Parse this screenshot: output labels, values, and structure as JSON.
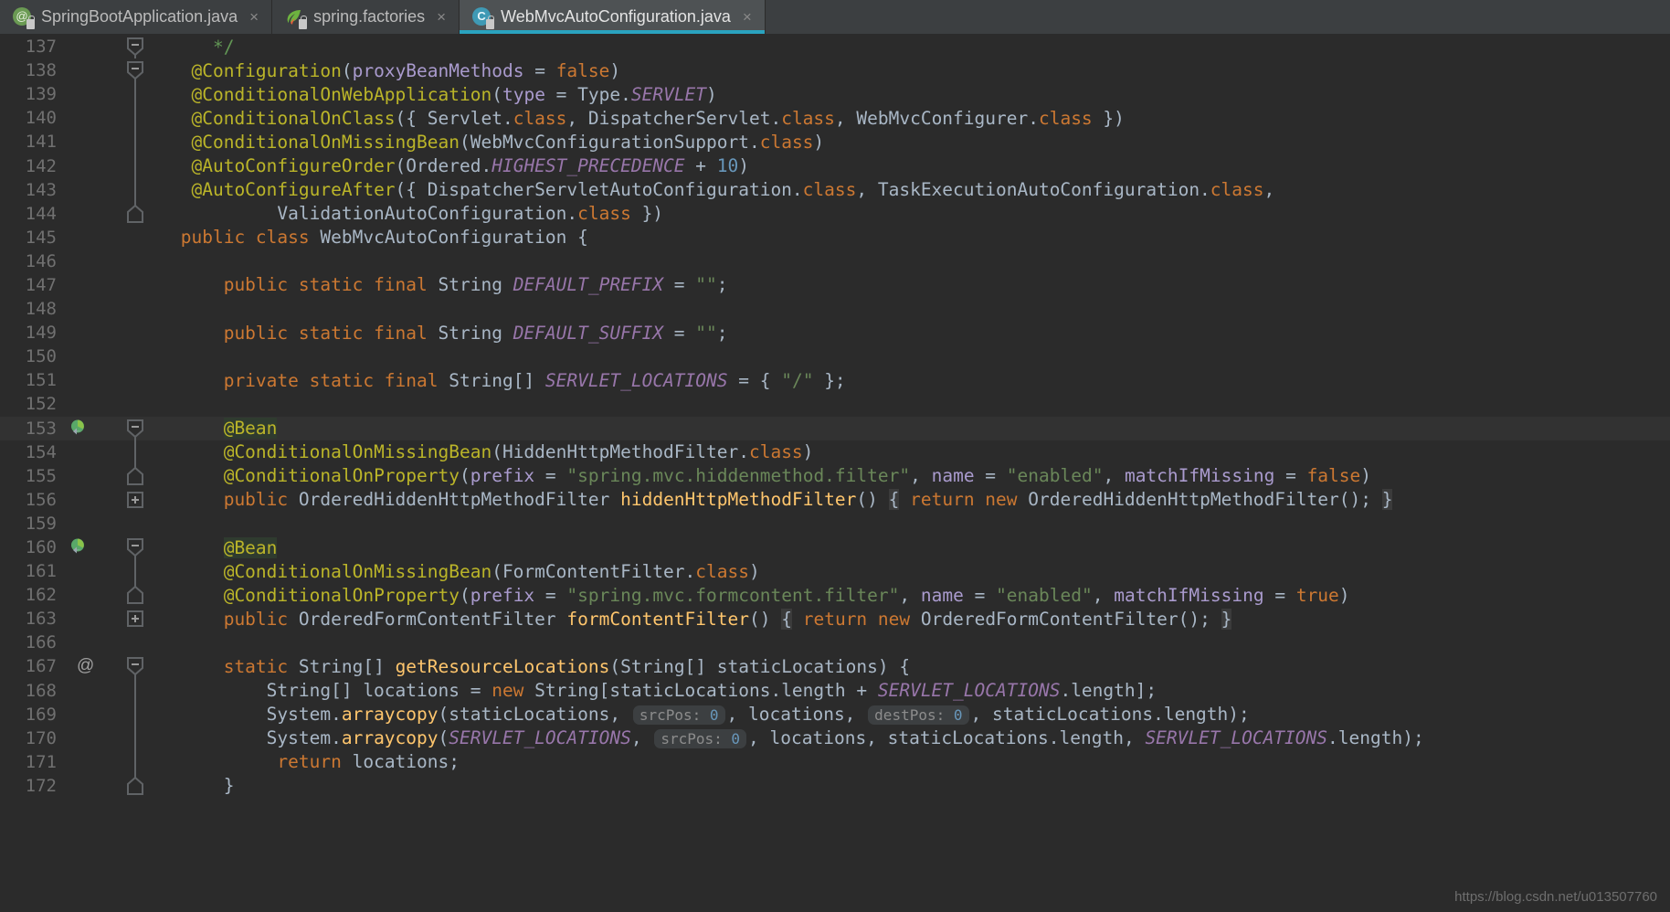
{
  "tabs": [
    {
      "label": "SpringBootApplication.java",
      "icon": "at-annotation-icon",
      "active": false,
      "close": "×"
    },
    {
      "label": "spring.factories",
      "icon": "spring-leaf-icon",
      "active": false,
      "close": "×"
    },
    {
      "label": "WebMvcAutoConfiguration.java",
      "icon": "java-class-icon",
      "active": true,
      "close": "×"
    }
  ],
  "editor": {
    "file": "WebMvcAutoConfiguration.java",
    "watermark": "https://blog.csdn.net/u013507760",
    "accent_color": "#2aa3bf",
    "background": "#2b2b2b",
    "lines": [
      {
        "n": "137",
        "gutter": "",
        "fold": "fold-open",
        "tokens": [
          {
            "t": "    ",
            "c": "typ"
          },
          {
            "t": "*/",
            "c": "cmt"
          }
        ]
      },
      {
        "n": "138",
        "gutter": "",
        "fold": "fold-open",
        "tokens": [
          {
            "t": "  ",
            "c": "typ"
          },
          {
            "t": "@Configuration",
            "c": "ann"
          },
          {
            "t": "(",
            "c": "typ"
          },
          {
            "t": "proxyBeanMethods",
            "c": "par"
          },
          {
            "t": " = ",
            "c": "typ"
          },
          {
            "t": "false",
            "c": "kw"
          },
          {
            "t": ")",
            "c": "typ"
          }
        ]
      },
      {
        "n": "139",
        "gutter": "",
        "fold": "line",
        "tokens": [
          {
            "t": "  ",
            "c": "typ"
          },
          {
            "t": "@ConditionalOnWebApplication",
            "c": "ann"
          },
          {
            "t": "(",
            "c": "typ"
          },
          {
            "t": "type",
            "c": "par"
          },
          {
            "t": " = Type.",
            "c": "typ"
          },
          {
            "t": "SERVLET",
            "c": "cst"
          },
          {
            "t": ")",
            "c": "typ"
          }
        ]
      },
      {
        "n": "140",
        "gutter": "",
        "fold": "line",
        "tokens": [
          {
            "t": "  ",
            "c": "typ"
          },
          {
            "t": "@ConditionalOnClass",
            "c": "ann"
          },
          {
            "t": "({ Servlet.",
            "c": "typ"
          },
          {
            "t": "class",
            "c": "kw"
          },
          {
            "t": ", DispatcherServlet.",
            "c": "typ"
          },
          {
            "t": "class",
            "c": "kw"
          },
          {
            "t": ", WebMvcConfigurer.",
            "c": "typ"
          },
          {
            "t": "class",
            "c": "kw"
          },
          {
            "t": " })",
            "c": "typ"
          }
        ]
      },
      {
        "n": "141",
        "gutter": "",
        "fold": "line",
        "tokens": [
          {
            "t": "  ",
            "c": "typ"
          },
          {
            "t": "@ConditionalOnMissingBean",
            "c": "ann"
          },
          {
            "t": "(WebMvcConfigurationSupport.",
            "c": "typ"
          },
          {
            "t": "class",
            "c": "kw"
          },
          {
            "t": ")",
            "c": "typ"
          }
        ]
      },
      {
        "n": "142",
        "gutter": "",
        "fold": "line",
        "tokens": [
          {
            "t": "  ",
            "c": "typ"
          },
          {
            "t": "@AutoConfigureOrder",
            "c": "ann"
          },
          {
            "t": "(Ordered.",
            "c": "typ"
          },
          {
            "t": "HIGHEST_PRECEDENCE",
            "c": "cst"
          },
          {
            "t": " + ",
            "c": "typ"
          },
          {
            "t": "10",
            "c": "num"
          },
          {
            "t": ")",
            "c": "typ"
          }
        ]
      },
      {
        "n": "143",
        "gutter": "",
        "fold": "line",
        "tokens": [
          {
            "t": "  ",
            "c": "typ"
          },
          {
            "t": "@AutoConfigureAfter",
            "c": "ann"
          },
          {
            "t": "({ DispatcherServletAutoConfiguration.",
            "c": "typ"
          },
          {
            "t": "class",
            "c": "kw"
          },
          {
            "t": ", TaskExecutionAutoConfiguration.",
            "c": "typ"
          },
          {
            "t": "class",
            "c": "kw"
          },
          {
            "t": ",",
            "c": "typ"
          }
        ]
      },
      {
        "n": "144",
        "gutter": "",
        "fold": "fold-close",
        "tokens": [
          {
            "t": "          ValidationAutoConfiguration.",
            "c": "typ"
          },
          {
            "t": "class",
            "c": "kw"
          },
          {
            "t": " })",
            "c": "typ"
          }
        ]
      },
      {
        "n": "145",
        "gutter": "",
        "fold": "",
        "tokens": [
          {
            "t": " ",
            "c": "typ"
          },
          {
            "t": "public class",
            "c": "kw"
          },
          {
            "t": " WebMvcAutoConfiguration {",
            "c": "typ"
          }
        ]
      },
      {
        "n": "146",
        "gutter": "",
        "fold": "",
        "tokens": []
      },
      {
        "n": "147",
        "gutter": "",
        "fold": "",
        "tokens": [
          {
            "t": "     ",
            "c": "typ"
          },
          {
            "t": "public static final",
            "c": "kw"
          },
          {
            "t": " String ",
            "c": "typ"
          },
          {
            "t": "DEFAULT_PREFIX",
            "c": "cst"
          },
          {
            "t": " = ",
            "c": "typ"
          },
          {
            "t": "\"\"",
            "c": "str"
          },
          {
            "t": ";",
            "c": "typ"
          }
        ]
      },
      {
        "n": "148",
        "gutter": "",
        "fold": "",
        "tokens": []
      },
      {
        "n": "149",
        "gutter": "",
        "fold": "",
        "tokens": [
          {
            "t": "     ",
            "c": "typ"
          },
          {
            "t": "public static final",
            "c": "kw"
          },
          {
            "t": " String ",
            "c": "typ"
          },
          {
            "t": "DEFAULT_SUFFIX",
            "c": "cst"
          },
          {
            "t": " = ",
            "c": "typ"
          },
          {
            "t": "\"\"",
            "c": "str"
          },
          {
            "t": ";",
            "c": "typ"
          }
        ]
      },
      {
        "n": "150",
        "gutter": "",
        "fold": "",
        "tokens": []
      },
      {
        "n": "151",
        "gutter": "",
        "fold": "",
        "tokens": [
          {
            "t": "     ",
            "c": "typ"
          },
          {
            "t": "private static final",
            "c": "kw"
          },
          {
            "t": " String[] ",
            "c": "typ"
          },
          {
            "t": "SERVLET_LOCATIONS",
            "c": "cst"
          },
          {
            "t": " = { ",
            "c": "typ"
          },
          {
            "t": "\"/\"",
            "c": "str"
          },
          {
            "t": " };",
            "c": "typ"
          }
        ]
      },
      {
        "n": "152",
        "gutter": "",
        "fold": "",
        "tokens": []
      },
      {
        "n": "153",
        "gutter": "bean",
        "fold": "fold-open",
        "highlight": true,
        "tokens": [
          {
            "t": "     ",
            "c": "typ"
          },
          {
            "t": "@Bean",
            "c": "ann beanhl"
          }
        ]
      },
      {
        "n": "154",
        "gutter": "",
        "fold": "line",
        "tokens": [
          {
            "t": "     ",
            "c": "typ"
          },
          {
            "t": "@ConditionalOnMissingBean",
            "c": "ann"
          },
          {
            "t": "(HiddenHttpMethodFilter.",
            "c": "typ"
          },
          {
            "t": "class",
            "c": "kw"
          },
          {
            "t": ")",
            "c": "typ"
          }
        ]
      },
      {
        "n": "155",
        "gutter": "",
        "fold": "fold-close",
        "tokens": [
          {
            "t": "     ",
            "c": "typ"
          },
          {
            "t": "@ConditionalOnProperty",
            "c": "ann"
          },
          {
            "t": "(",
            "c": "typ"
          },
          {
            "t": "prefix",
            "c": "par"
          },
          {
            "t": " = ",
            "c": "typ"
          },
          {
            "t": "\"spring.mvc.hiddenmethod.filter\"",
            "c": "str"
          },
          {
            "t": ", ",
            "c": "typ"
          },
          {
            "t": "name",
            "c": "par"
          },
          {
            "t": " = ",
            "c": "typ"
          },
          {
            "t": "\"enabled\"",
            "c": "str"
          },
          {
            "t": ", ",
            "c": "typ"
          },
          {
            "t": "matchIfMissing",
            "c": "par"
          },
          {
            "t": " = ",
            "c": "typ"
          },
          {
            "t": "false",
            "c": "kw"
          },
          {
            "t": ")",
            "c": "typ"
          }
        ]
      },
      {
        "n": "156",
        "gutter": "",
        "fold": "fold-plus",
        "tokens": [
          {
            "t": "     ",
            "c": "typ"
          },
          {
            "t": "public",
            "c": "kw"
          },
          {
            "t": " OrderedHiddenHttpMethodFilter ",
            "c": "typ"
          },
          {
            "t": "hiddenHttpMethodFilter",
            "c": "mth"
          },
          {
            "t": "() ",
            "c": "typ"
          },
          {
            "t": "{",
            "c": "typ bracehl"
          },
          {
            "t": " ",
            "c": "typ"
          },
          {
            "t": "return new",
            "c": "kw"
          },
          {
            "t": " OrderedHiddenHttpMethodFilter(); ",
            "c": "typ"
          },
          {
            "t": "}",
            "c": "typ bracehl"
          }
        ]
      },
      {
        "n": "159",
        "gutter": "",
        "fold": "",
        "tokens": []
      },
      {
        "n": "160",
        "gutter": "bean",
        "fold": "fold-open",
        "tokens": [
          {
            "t": "     ",
            "c": "typ"
          },
          {
            "t": "@Bean",
            "c": "ann beanhl"
          }
        ]
      },
      {
        "n": "161",
        "gutter": "",
        "fold": "line",
        "tokens": [
          {
            "t": "     ",
            "c": "typ"
          },
          {
            "t": "@ConditionalOnMissingBean",
            "c": "ann"
          },
          {
            "t": "(FormContentFilter.",
            "c": "typ"
          },
          {
            "t": "class",
            "c": "kw"
          },
          {
            "t": ")",
            "c": "typ"
          }
        ]
      },
      {
        "n": "162",
        "gutter": "",
        "fold": "fold-close",
        "tokens": [
          {
            "t": "     ",
            "c": "typ"
          },
          {
            "t": "@ConditionalOnProperty",
            "c": "ann"
          },
          {
            "t": "(",
            "c": "typ"
          },
          {
            "t": "prefix",
            "c": "par"
          },
          {
            "t": " = ",
            "c": "typ"
          },
          {
            "t": "\"spring.mvc.formcontent.filter\"",
            "c": "str"
          },
          {
            "t": ", ",
            "c": "typ"
          },
          {
            "t": "name",
            "c": "par"
          },
          {
            "t": " = ",
            "c": "typ"
          },
          {
            "t": "\"enabled\"",
            "c": "str"
          },
          {
            "t": ", ",
            "c": "typ"
          },
          {
            "t": "matchIfMissing",
            "c": "par"
          },
          {
            "t": " = ",
            "c": "typ"
          },
          {
            "t": "true",
            "c": "kw"
          },
          {
            "t": ")",
            "c": "typ"
          }
        ]
      },
      {
        "n": "163",
        "gutter": "",
        "fold": "fold-plus",
        "tokens": [
          {
            "t": "     ",
            "c": "typ"
          },
          {
            "t": "public",
            "c": "kw"
          },
          {
            "t": " OrderedFormContentFilter ",
            "c": "typ"
          },
          {
            "t": "formContentFilter",
            "c": "mth"
          },
          {
            "t": "() ",
            "c": "typ"
          },
          {
            "t": "{",
            "c": "typ bracehl"
          },
          {
            "t": " ",
            "c": "typ"
          },
          {
            "t": "return new",
            "c": "kw"
          },
          {
            "t": " OrderedFormContentFilter(); ",
            "c": "typ"
          },
          {
            "t": "}",
            "c": "typ bracehl"
          }
        ]
      },
      {
        "n": "166",
        "gutter": "",
        "fold": "",
        "tokens": []
      },
      {
        "n": "167",
        "gutter": "at",
        "fold": "fold-open",
        "tokens": [
          {
            "t": "     ",
            "c": "typ"
          },
          {
            "t": "static",
            "c": "kw"
          },
          {
            "t": " String[] ",
            "c": "typ"
          },
          {
            "t": "getResourceLocations",
            "c": "mth"
          },
          {
            "t": "(String[] staticLocations) {",
            "c": "typ"
          }
        ]
      },
      {
        "n": "168",
        "gutter": "",
        "fold": "line",
        "tokens": [
          {
            "t": "         String[] locations = ",
            "c": "typ"
          },
          {
            "t": "new",
            "c": "kw"
          },
          {
            "t": " String[staticLocations.length + ",
            "c": "typ"
          },
          {
            "t": "SERVLET_LOCATIONS",
            "c": "cst"
          },
          {
            "t": ".length];",
            "c": "typ"
          }
        ]
      },
      {
        "n": "169",
        "gutter": "",
        "fold": "line",
        "tokens": [
          {
            "t": "         System.",
            "c": "typ"
          },
          {
            "t": "arraycopy",
            "c": "mth"
          },
          {
            "t": "(staticLocations, ",
            "c": "typ"
          },
          {
            "t": "srcPos:",
            "c": "hint",
            "hint": true,
            "after": "0"
          },
          {
            "t": ", locations, ",
            "c": "typ"
          },
          {
            "t": "destPos:",
            "c": "hint",
            "hint": true,
            "after": "0"
          },
          {
            "t": ", staticLocations.length);",
            "c": "typ"
          }
        ]
      },
      {
        "n": "170",
        "gutter": "",
        "fold": "line",
        "tokens": [
          {
            "t": "         System.",
            "c": "typ"
          },
          {
            "t": "arraycopy",
            "c": "mth"
          },
          {
            "t": "(",
            "c": "typ"
          },
          {
            "t": "SERVLET_LOCATIONS",
            "c": "cst"
          },
          {
            "t": ", ",
            "c": "typ"
          },
          {
            "t": "srcPos:",
            "c": "hint",
            "hint": true,
            "after": "0"
          },
          {
            "t": ", locations, staticLocations.length, ",
            "c": "typ"
          },
          {
            "t": "SERVLET_LOCATIONS",
            "c": "cst"
          },
          {
            "t": ".length);",
            "c": "typ"
          }
        ]
      },
      {
        "n": "171",
        "gutter": "",
        "fold": "line",
        "tokens": [
          {
            "t": "          ",
            "c": "typ"
          },
          {
            "t": "return",
            "c": "kw"
          },
          {
            "t": " locations;",
            "c": "typ"
          }
        ]
      },
      {
        "n": "172",
        "gutter": "",
        "fold": "fold-close",
        "tokens": [
          {
            "t": "     }",
            "c": "typ"
          }
        ]
      }
    ]
  }
}
